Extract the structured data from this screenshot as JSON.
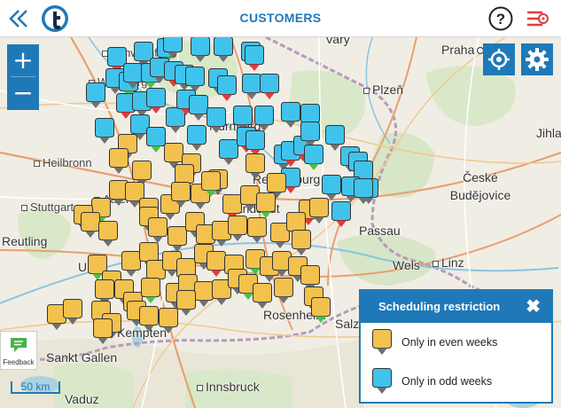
{
  "header": {
    "title": "CUSTOMERS"
  },
  "map": {
    "zoom_in": "+",
    "zoom_out": "−",
    "scale_label": "50 km",
    "feedback_label": "Feedback",
    "places": [
      {
        "name": "Schweinfurt",
        "dot": true
      },
      {
        "name": "Würzburg",
        "dot": true
      },
      {
        "name": "Vary",
        "dot": false
      },
      {
        "name": "Praha",
        "dot": false,
        "capital": true
      },
      {
        "name": "Plzeň",
        "dot": true
      },
      {
        "name": "Jihla",
        "dot": false
      },
      {
        "name": "Heilbronn",
        "dot": true
      },
      {
        "name": "České Budějovice",
        "dot": false
      },
      {
        "name": "Aalen",
        "dot": true
      },
      {
        "name": "Stuttgart",
        "dot": true
      },
      {
        "name": "Passau",
        "dot": false
      },
      {
        "name": "Reutling",
        "dot": false
      },
      {
        "name": "Ulm",
        "dot": false
      },
      {
        "name": "Wels",
        "dot": false
      },
      {
        "name": "Linz",
        "dot": true
      },
      {
        "name": "Kempten",
        "dot": false
      },
      {
        "name": "Rosenheim",
        "dot": false
      },
      {
        "name": "Salzburg",
        "dot": false
      },
      {
        "name": "Sankt Gallen",
        "dot": false
      },
      {
        "name": "Innsbruck",
        "dot": true
      },
      {
        "name": "Vaduz",
        "dot": false
      },
      {
        "name": "Nürnberg",
        "dot": false
      },
      {
        "name": "Regensburg",
        "dot": false
      },
      {
        "name": "Landshut",
        "dot": false
      }
    ]
  },
  "legend": {
    "title": "Scheduling restriction",
    "close_icon": "close-icon",
    "items": [
      {
        "label": "Only in even weeks",
        "color": "#f2c14e"
      },
      {
        "label": "Only in odd weeks",
        "color": "#3fc3ec"
      }
    ]
  },
  "colors": {
    "brand": "#1f79b8",
    "even": "#f2c14e",
    "odd": "#3fc3ec",
    "tip_red": "#e23b3b",
    "tip_green": "#49c24a",
    "tip_gray": "#707070"
  }
}
